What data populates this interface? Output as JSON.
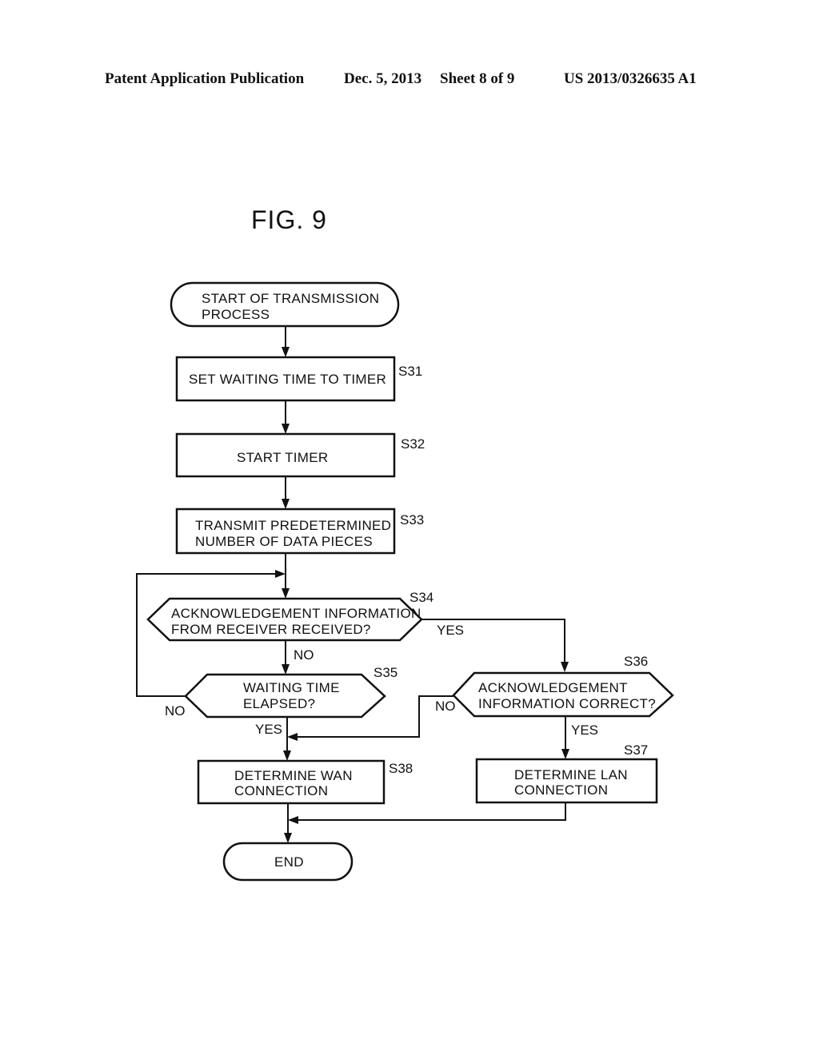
{
  "header": {
    "publication": "Patent Application Publication",
    "date": "Dec. 5, 2013",
    "sheet": "Sheet 8 of 9",
    "patent_number": "US 2013/0326635 A1"
  },
  "figure": {
    "title": "FIG. 9"
  },
  "nodes": {
    "start": {
      "line1": "START OF TRANSMISSION",
      "line2": "PROCESS"
    },
    "s31": {
      "step": "S31",
      "line1": "SET WAITING TIME TO TIMER"
    },
    "s32": {
      "step": "S32",
      "line1": "START TIMER"
    },
    "s33": {
      "step": "S33",
      "line1": "TRANSMIT PREDETERMINED",
      "line2": "NUMBER OF DATA PIECES"
    },
    "s34": {
      "step": "S34",
      "line1": "ACKNOWLEDGEMENT INFORMATION",
      "line2": "FROM RECEIVER RECEIVED?",
      "yes": "YES",
      "no": "NO"
    },
    "s35": {
      "step": "S35",
      "line1": "WAITING TIME",
      "line2": "ELAPSED?",
      "yes": "YES",
      "no": "NO"
    },
    "s36": {
      "step": "S36",
      "line1": "ACKNOWLEDGEMENT",
      "line2": "INFORMATION CORRECT?",
      "yes": "YES",
      "no": "NO"
    },
    "s37": {
      "step": "S37",
      "line1": "DETERMINE LAN",
      "line2": "CONNECTION"
    },
    "s38": {
      "step": "S38",
      "line1": "DETERMINE WAN",
      "line2": "CONNECTION"
    },
    "end": {
      "line1": "END"
    }
  }
}
